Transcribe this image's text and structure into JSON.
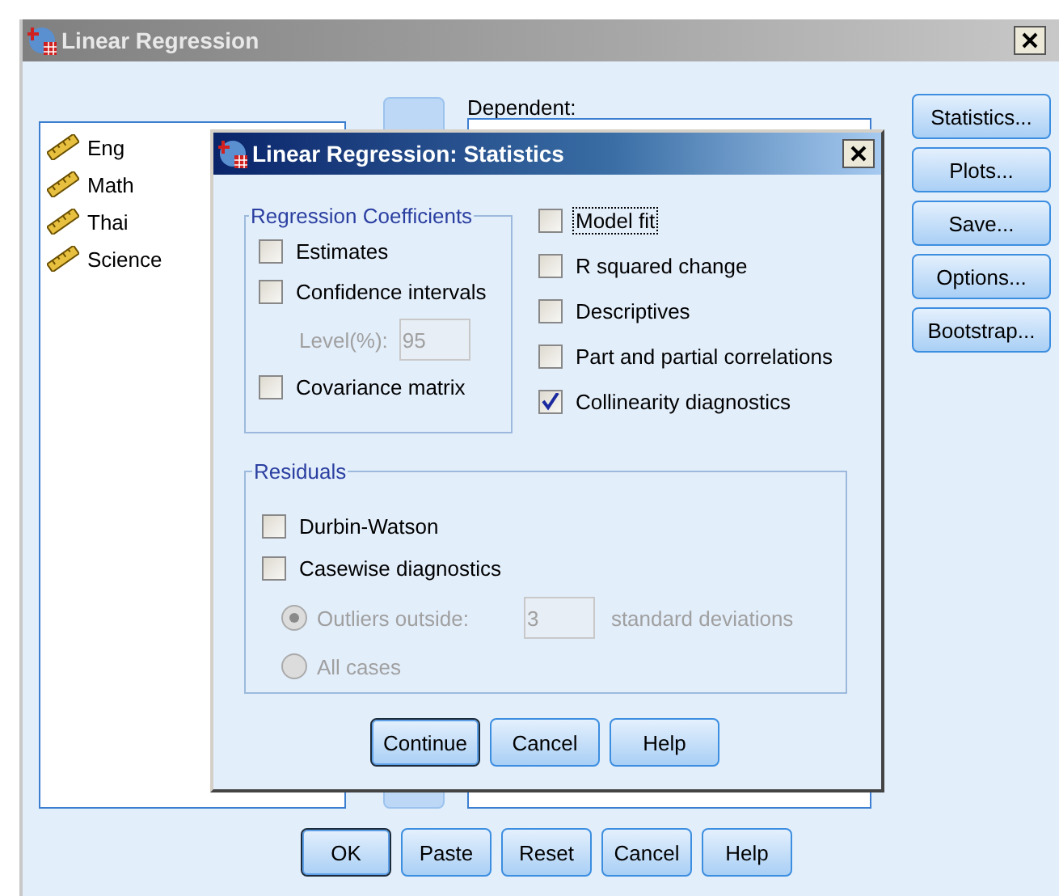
{
  "window": {
    "title": "Linear Regression"
  },
  "variables": [
    {
      "name": "Eng"
    },
    {
      "name": "Math"
    },
    {
      "name": "Thai"
    },
    {
      "name": "Science"
    }
  ],
  "dependent": {
    "label": "Dependent:"
  },
  "side_buttons": [
    {
      "label": "Statistics..."
    },
    {
      "label": "Plots..."
    },
    {
      "label": "Save..."
    },
    {
      "label": "Options..."
    },
    {
      "label": "Bootstrap..."
    }
  ],
  "buttons": [
    {
      "label": "OK",
      "default": true
    },
    {
      "label": "Paste",
      "default": false
    },
    {
      "label": "Reset",
      "default": false
    },
    {
      "label": "Cancel",
      "default": false
    },
    {
      "label": "Help",
      "default": false
    }
  ],
  "dialog": {
    "title": "Linear Regression: Statistics",
    "coefficients": {
      "title": "Regression Coefficients",
      "items": [
        {
          "kind": "checkbox",
          "label": "Estimates",
          "checked": false
        },
        {
          "kind": "checkbox",
          "label": "Confidence intervals",
          "checked": false
        },
        {
          "kind": "level",
          "label": "Level(%):",
          "value": "95",
          "disabled": true
        },
        {
          "kind": "checkbox",
          "label": "Covariance matrix",
          "checked": false
        }
      ]
    },
    "options": [
      {
        "label": "Model fit",
        "checked": false,
        "focused": true
      },
      {
        "label": "R squared change",
        "checked": false,
        "focused": false
      },
      {
        "label": "Descriptives",
        "checked": false,
        "focused": false
      },
      {
        "label": "Part and partial correlations",
        "checked": false,
        "focused": false
      },
      {
        "label": "Collinearity diagnostics",
        "checked": true,
        "focused": false
      }
    ],
    "residuals": {
      "title": "Residuals",
      "checks": [
        {
          "label": "Durbin-Watson",
          "checked": false
        },
        {
          "label": "Casewise diagnostics",
          "checked": false
        }
      ],
      "radios": [
        {
          "kind": "outliers",
          "label": "Outliers outside:",
          "value": "3",
          "unit": "standard deviations",
          "selected": true,
          "disabled": true
        },
        {
          "kind": "plain",
          "label": "All cases",
          "selected": false,
          "disabled": true
        }
      ]
    },
    "buttons": [
      {
        "label": "Continue",
        "default": true
      },
      {
        "label": "Cancel",
        "default": false
      },
      {
        "label": "Help",
        "default": false
      }
    ]
  }
}
